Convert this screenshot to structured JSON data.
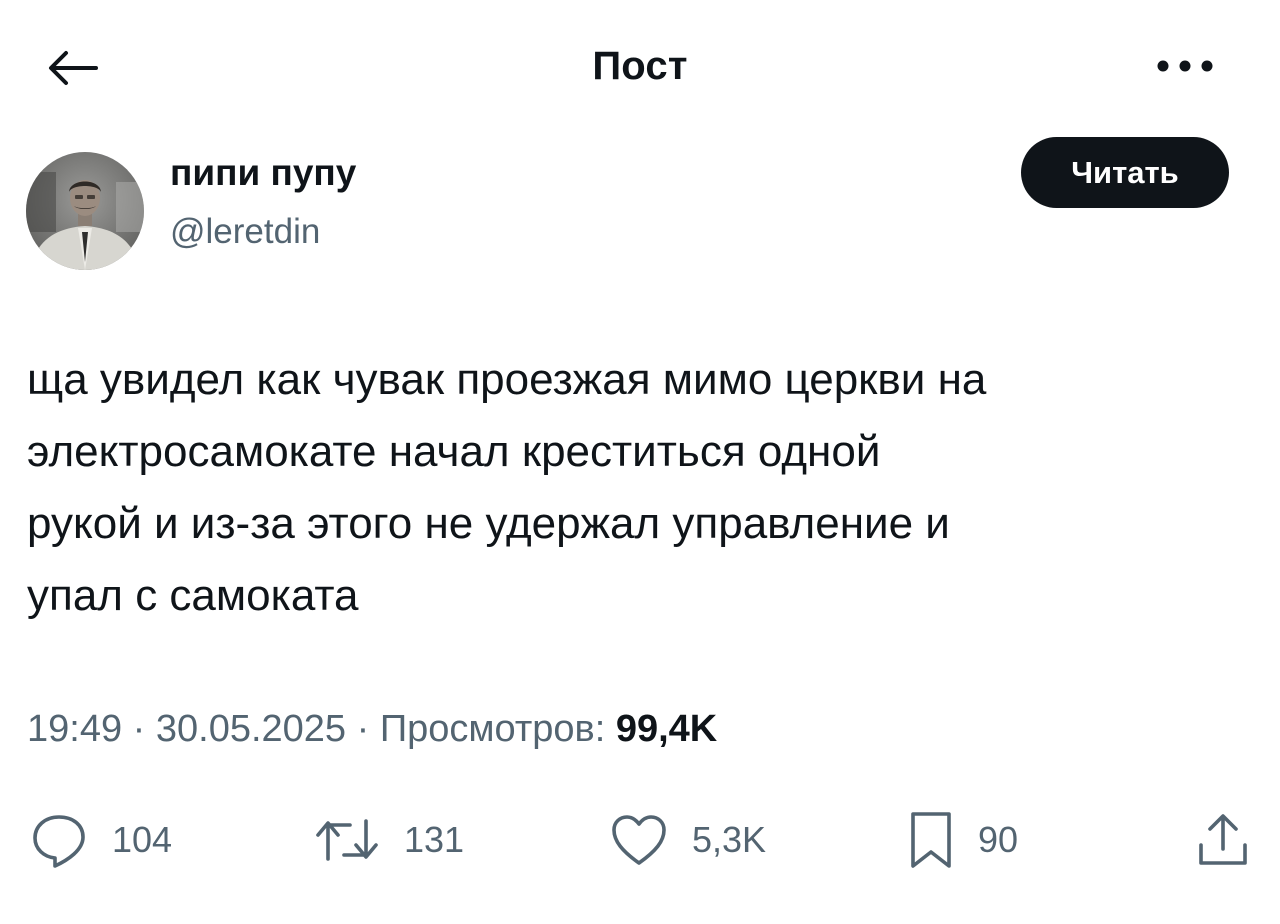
{
  "header": {
    "title": "Пост",
    "back_icon": "arrow-left-icon",
    "more_icon": "more-horizontal-icon"
  },
  "author": {
    "name": "пипи пупу",
    "handle": "@leretdin",
    "follow_label": "Читать"
  },
  "post": {
    "lines": [
      "ща увидел как чувак проезжая мимо церкви на",
      "электросамокате начал креститься одной",
      "рукой и из-за этого не удержал управление и",
      "упал с самоката"
    ]
  },
  "meta": {
    "time": "19:49",
    "separator": " · ",
    "date": "30.05.2025",
    "views_label": "Просмотров:",
    "views_count": "99,4K"
  },
  "actions": {
    "replies": {
      "icon": "reply-icon",
      "count": "104"
    },
    "reposts": {
      "icon": "repost-icon",
      "count": "131"
    },
    "likes": {
      "icon": "heart-icon",
      "count": "5,3K"
    },
    "bookmarks": {
      "icon": "bookmark-icon",
      "count": "90"
    },
    "share": {
      "icon": "share-icon"
    }
  },
  "colors": {
    "text_primary": "#0f1419",
    "text_secondary": "#536471",
    "button_bg": "#0f1419",
    "button_text": "#ffffff"
  }
}
